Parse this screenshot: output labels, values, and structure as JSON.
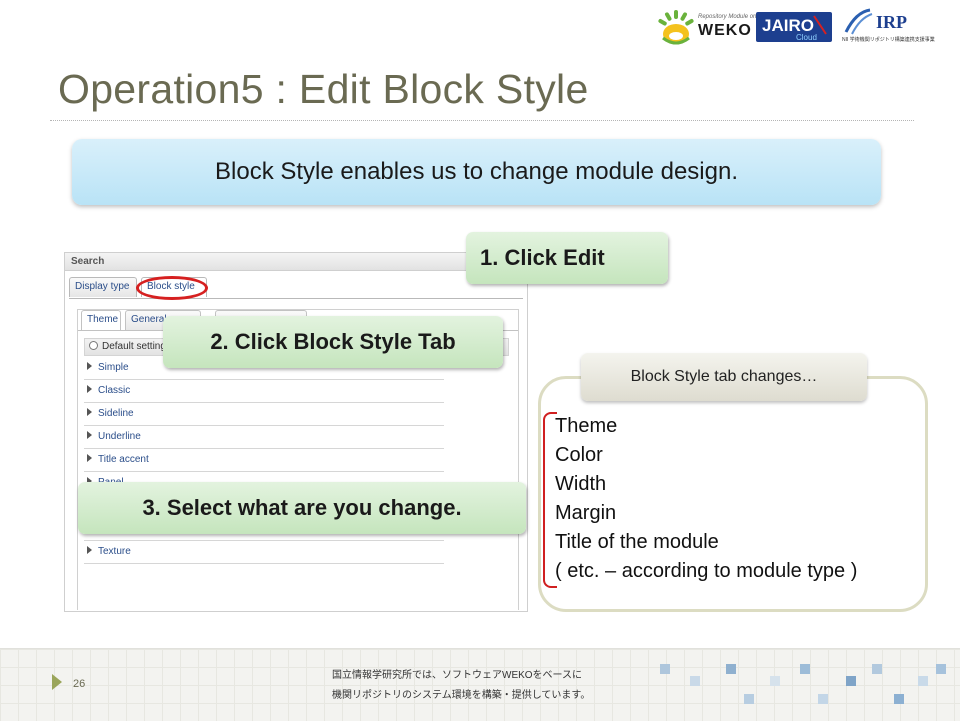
{
  "header": {
    "logos": [
      {
        "name": "weko",
        "small_text": "Repository Module on NC2",
        "text": "WEKO"
      },
      {
        "name": "jairo",
        "text": "JAIRO",
        "sub": "Cloud"
      },
      {
        "name": "irp",
        "text": "IRP",
        "sub": "NII 学術機関リポジトリ構築連携支援事業"
      }
    ]
  },
  "slide": {
    "title": "Operation5 : Edit Block Style",
    "banner": "Block Style enables us to change module design."
  },
  "screenshot": {
    "panel_title": "Search",
    "tabs": [
      "Display type",
      "Block style"
    ],
    "inner_tabs": [
      "Theme",
      "General"
    ],
    "default_setting": "Default setting",
    "items": [
      "Simple",
      "Classic",
      "Sideline",
      "Underline",
      "Title accent",
      "Panel",
      "Texture"
    ]
  },
  "callouts": {
    "step1": "1.  Click Edit",
    "step2": "2.  Click Block Style Tab",
    "step3": "3.  Select what are you change."
  },
  "changes": {
    "label": "Block Style tab changes…",
    "items": [
      "Theme",
      "Color",
      "Width",
      "Margin",
      "Title of the module",
      "( etc. – according to module type )"
    ]
  },
  "footer": {
    "page_number": "26",
    "line1": "国立情報学研究所では、ソフトウェアWEKOをベースに",
    "line2": "機関リポジトリのシステム環境を構築・提供しています。"
  },
  "colors": {
    "title": "#6a6a52",
    "banner": "#c9e9f8",
    "callout": "#d3ecce",
    "highlight": "#d62020",
    "accent": "#9aa55a"
  }
}
